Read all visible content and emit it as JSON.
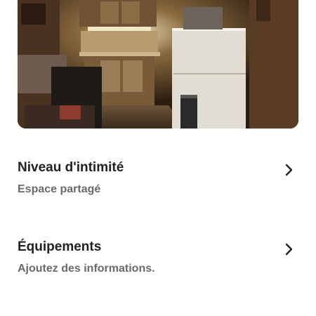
{
  "listing_photo": {
    "icon": "kitchen-photo"
  },
  "rows": [
    {
      "title": "Niveau d'intimité",
      "subtitle": "Espace partagé",
      "icon": "chevron-right-icon"
    },
    {
      "title": "Équipements",
      "subtitle": "Ajoutez des informations.",
      "icon": "chevron-right-icon"
    }
  ],
  "colors": {
    "title": "#222222",
    "subtitle": "#6a6a6a",
    "background": "#ffffff"
  }
}
